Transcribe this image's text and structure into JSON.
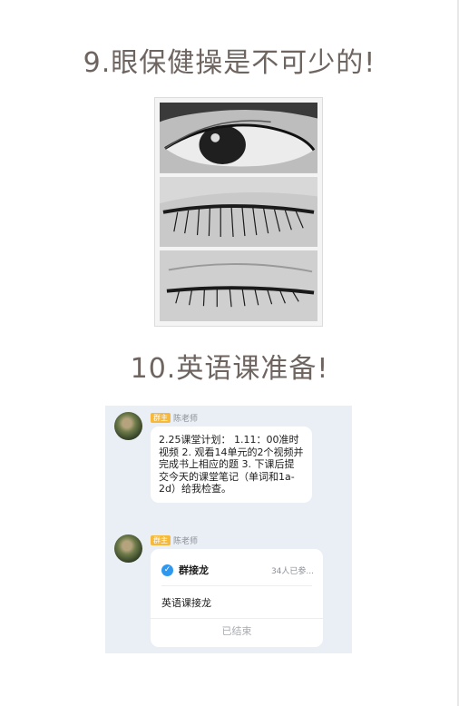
{
  "headings": {
    "h9": "9.眼保健操是不可少的!",
    "h10": "10.英语课准备!"
  },
  "chat": {
    "messages": [
      {
        "role_badge": "群主",
        "sender": "陈老师",
        "text": "2.25课堂计划： 1.11：00准时视频 2. 观看14单元的2个视频并完成书上相应的题 3. 下课后提交今天的课堂笔记（单词和1a-2d）给我检查。"
      }
    ],
    "card": {
      "role_badge": "群主",
      "sender": "陈老师",
      "title": "群接龙",
      "count": "34人已参...",
      "body": "英语课接龙",
      "footer": "已结束"
    }
  },
  "icons": {
    "check": "check-circle-icon"
  },
  "colors": {
    "heading": "#6e6460",
    "badge": "#f5b93c",
    "chat_bg": "#eaeef5",
    "check": "#2e98f0"
  }
}
